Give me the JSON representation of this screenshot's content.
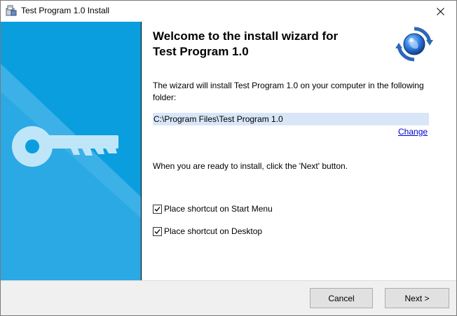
{
  "window": {
    "title": "Test Program 1.0 Install"
  },
  "header": {
    "heading": "Welcome to the install wizard for\nTest Program 1.0"
  },
  "body": {
    "intro": "The wizard will install Test Program 1.0 on your computer in the following folder:",
    "folder_path": "C:\\Program Files\\Test Program 1.0",
    "change_link": "Change",
    "ready_text": "When you are ready to install, click the 'Next' button."
  },
  "options": [
    {
      "label": "Place shortcut on Start Menu",
      "checked": true
    },
    {
      "label": "Place shortcut on Desktop",
      "checked": true
    }
  ],
  "buttons": {
    "cancel": "Cancel",
    "next": "Next >"
  },
  "colors": {
    "sidebar": "#0b9ede",
    "sidebar_light": "#47b6e8",
    "link": "#0000cc"
  },
  "icons": {
    "app": "installer-icon",
    "wizard": "refresh-globe-icon",
    "sidebar": "key-icon"
  }
}
